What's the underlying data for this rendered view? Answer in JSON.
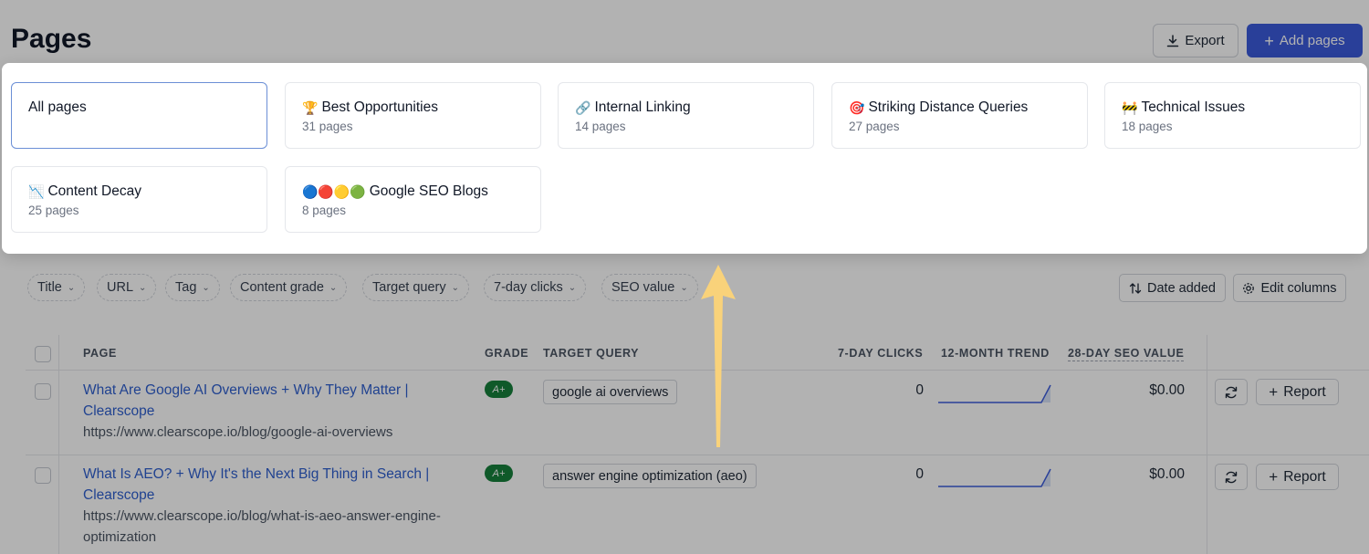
{
  "header": {
    "title": "Pages",
    "export_label": "Export",
    "add_label": "Add pages"
  },
  "filters": [
    "Title",
    "URL",
    "Tag",
    "Content grade",
    "Target query",
    "7-day clicks",
    "SEO value"
  ],
  "toolbar": {
    "sort_label": "Date added",
    "columns_label": "Edit columns"
  },
  "table": {
    "headers": {
      "page": "PAGE",
      "grade": "GRADE",
      "query": "TARGET QUERY",
      "clicks": "7-DAY CLICKS",
      "trend": "12-MONTH TREND",
      "seo": "28-DAY SEO VALUE"
    },
    "rows": [
      {
        "title": "What Are Google AI Overviews + Why They Matter | Clearscope",
        "url": "https://www.clearscope.io/blog/google-ai-overviews",
        "grade": "A+",
        "query": "google ai overviews",
        "clicks": "0",
        "seo_value": "$0.00",
        "report_label": "Report"
      },
      {
        "title": "What Is AEO? + Why It's the Next Big Thing in Search | Clearscope",
        "url": "https://www.clearscope.io/blog/what-is-aeo-answer-engine-optimization",
        "grade": "A+",
        "query": "answer engine optimization (aeo)",
        "clicks": "0",
        "seo_value": "$0.00",
        "report_label": "Report"
      }
    ]
  },
  "views": [
    {
      "icon": "",
      "title": "All pages",
      "subtitle": ""
    },
    {
      "icon": "🏆",
      "title": "Best Opportunities",
      "subtitle": "31 pages"
    },
    {
      "icon": "🔗",
      "title": "Internal Linking",
      "subtitle": "14 pages"
    },
    {
      "icon": "🎯",
      "title": "Striking Distance Queries",
      "subtitle": "27 pages"
    },
    {
      "icon": "🚧",
      "title": "Technical Issues",
      "subtitle": "18 pages"
    },
    {
      "icon": "📉",
      "title": "Content Decay",
      "subtitle": "25 pages"
    },
    {
      "icon": "🔵🔴🟡🟢",
      "title": "Google SEO Blogs",
      "subtitle": "8 pages"
    }
  ],
  "colors": {
    "accent": "#3b5bdb",
    "link": "#2f5fcf",
    "grade_badge": "#16803c",
    "annotation_arrow": "#f9d27a"
  }
}
